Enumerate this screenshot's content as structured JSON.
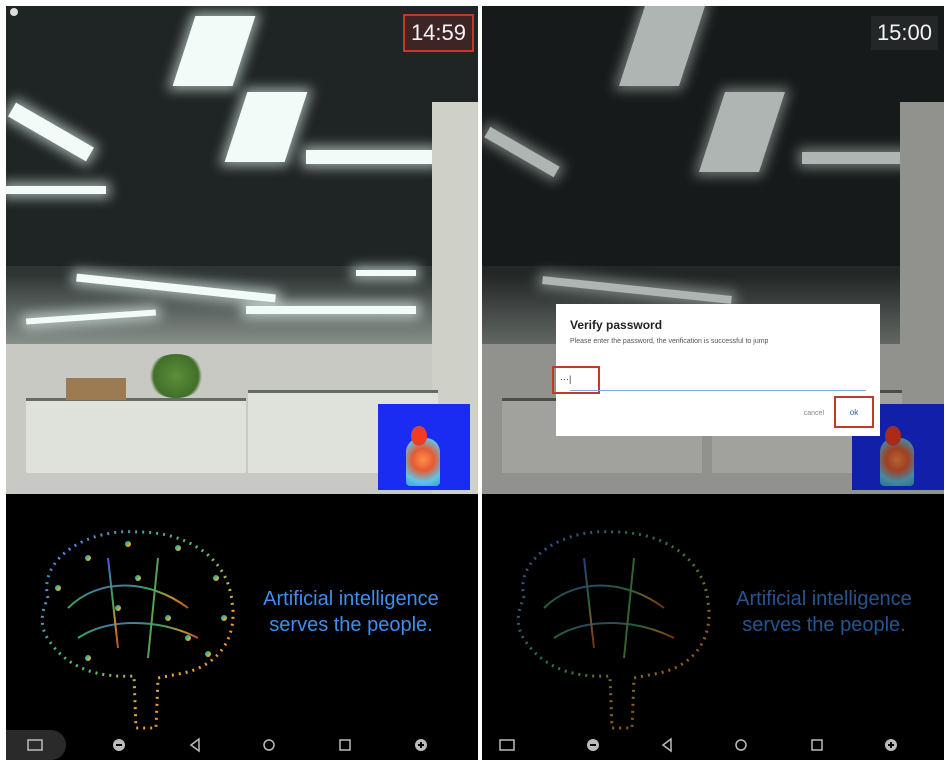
{
  "left_screen": {
    "clock": "14:59",
    "tagline_line1": "Artificial intelligence",
    "tagline_line2": "serves the people."
  },
  "right_screen": {
    "clock": "15:00",
    "tagline_line1": "Artificial intelligence",
    "tagline_line2": "serves the people.",
    "dialog": {
      "title": "Verify password",
      "message": "Please enter the password, the verification is successful to jump",
      "password_value": "···|",
      "cancel_label": "cancel",
      "ok_label": "ok"
    }
  },
  "nav_icons": [
    "screenshot-icon",
    "volume-down-icon",
    "back-icon",
    "home-icon",
    "recents-icon",
    "volume-up-icon"
  ],
  "colors": {
    "highlight": "#c0392b",
    "tagline": "#3f8ef0",
    "thermal_bg": "#1a2cf2"
  }
}
